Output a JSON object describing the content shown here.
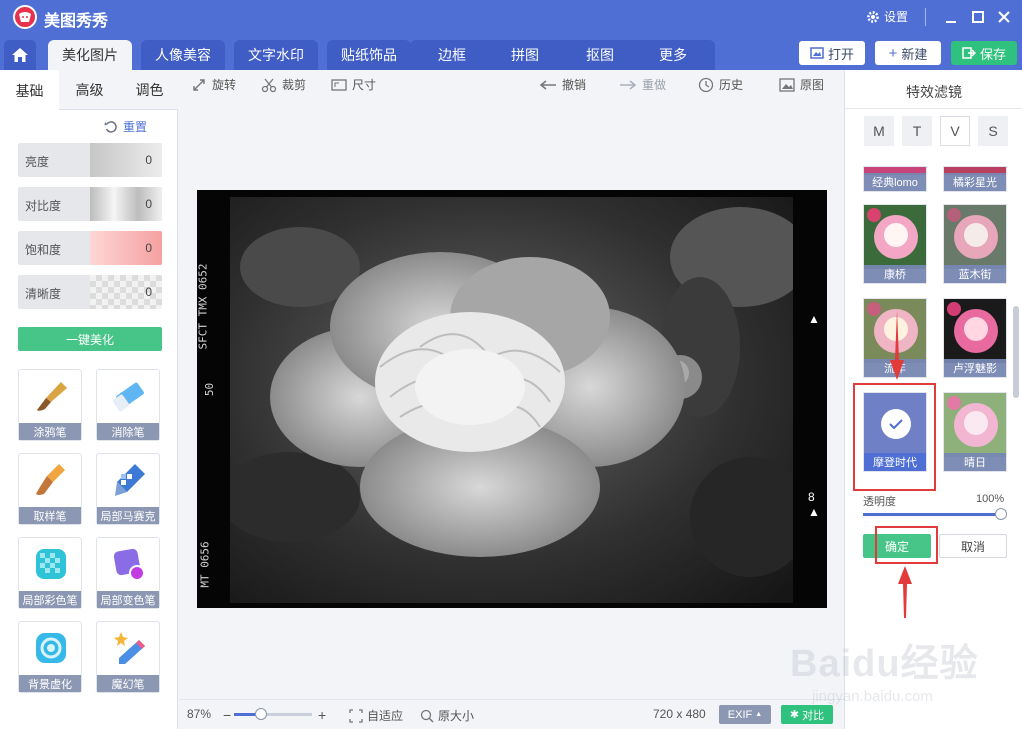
{
  "app": {
    "title": "美图秀秀",
    "settings_label": "设置"
  },
  "tabs": [
    {
      "label": "美化图片",
      "active": true
    },
    {
      "label": "人像美容"
    },
    {
      "label": "文字水印"
    },
    {
      "label": "贴纸饰品"
    },
    {
      "label": "边框"
    },
    {
      "label": "拼图"
    },
    {
      "label": "抠图"
    },
    {
      "label": "更多"
    }
  ],
  "top_actions": {
    "open": "打开",
    "new": "新建",
    "save": "保存"
  },
  "left_panel": {
    "subtabs": [
      "基础",
      "高级",
      "调色"
    ],
    "reset_label": "重置",
    "adjustments": [
      {
        "label": "亮度",
        "value": "0"
      },
      {
        "label": "对比度",
        "value": "0"
      },
      {
        "label": "饱和度",
        "value": "0"
      },
      {
        "label": "清晰度",
        "value": "0"
      }
    ],
    "one_key_label": "一键美化",
    "tools": [
      {
        "label": "涂鸦笔",
        "icon": "brush-icon"
      },
      {
        "label": "消除笔",
        "icon": "eraser-icon"
      },
      {
        "label": "取样笔",
        "icon": "sample-brush-icon"
      },
      {
        "label": "局部马赛克",
        "icon": "mosaic-pen-icon"
      },
      {
        "label": "局部彩色笔",
        "icon": "color-pen-icon"
      },
      {
        "label": "局部变色笔",
        "icon": "recolor-pen-icon"
      },
      {
        "label": "背景虚化",
        "icon": "background-blur-icon"
      },
      {
        "label": "魔幻笔",
        "icon": "magic-pen-icon"
      }
    ]
  },
  "toolbar": {
    "rotate": "旋转",
    "crop": "裁剪",
    "size": "尺寸",
    "undo": "撤销",
    "redo": "重做",
    "history": "历史",
    "original": "原图"
  },
  "film": {
    "code_top": "SFCT TMX 0652",
    "code_mid": "50",
    "code_bottom": "MT 0656",
    "mark": "8"
  },
  "status": {
    "zoom": "87%",
    "zoom_fraction": 0.35,
    "fit_label": "自适应",
    "actual_size_label": "原大小",
    "dimensions": "720 x 480",
    "exif_label": "EXIF",
    "compare_label": "对比"
  },
  "right_panel": {
    "title": "特效滤镜",
    "categories": [
      "M",
      "T",
      "V",
      "S"
    ],
    "selected_category": "V",
    "filters": [
      {
        "label": "经典lomo"
      },
      {
        "label": "橘彩星光"
      },
      {
        "label": "康桥"
      },
      {
        "label": "蓝木街"
      },
      {
        "label": "流年"
      },
      {
        "label": "卢浮魅影"
      },
      {
        "label": "摩登时代",
        "selected": true
      },
      {
        "label": "晴日"
      }
    ],
    "opacity_label": "透明度",
    "opacity_value": "100%",
    "opacity_fraction": 1.0,
    "confirm_label": "确定",
    "cancel_label": "取消"
  },
  "watermark": {
    "line1": "Baidu经验",
    "line2": "jingyan.baidu.com"
  },
  "colors": {
    "brand_blue": "#4f6fd4",
    "green": "#2ec27e",
    "highlight_red": "#e23b3b"
  }
}
